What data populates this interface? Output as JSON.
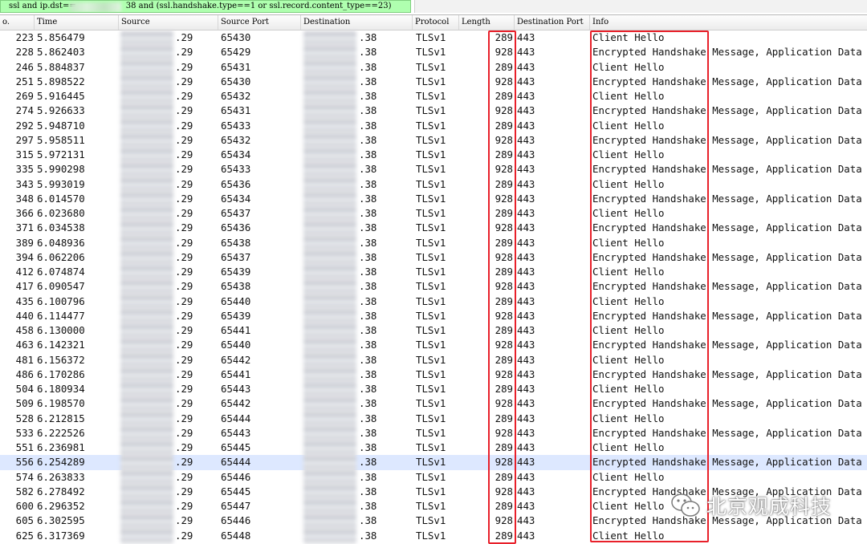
{
  "filter": {
    "text_start": "ssl and ip.dst==",
    "text_end": "38 and (ssl.handshake.type==1 or ssl.record.content_type==23)"
  },
  "columns": [
    "o.",
    "Time",
    "Source",
    "Source Port",
    "Destination",
    "Protocol",
    "Length",
    "Destination Port",
    "Info"
  ],
  "packets": [
    {
      "no": "223",
      "time": "5.856479",
      "src": ".29",
      "sport": "65430",
      "dst": ".38",
      "proto": "TLSv1",
      "len": "289",
      "dport": "443",
      "info": "Client Hello"
    },
    {
      "no": "228",
      "time": "5.862403",
      "src": ".29",
      "sport": "65429",
      "dst": ".38",
      "proto": "TLSv1",
      "len": "928",
      "dport": "443",
      "info": "Encrypted Handshake Message, Application Data"
    },
    {
      "no": "246",
      "time": "5.884837",
      "src": ".29",
      "sport": "65431",
      "dst": ".38",
      "proto": "TLSv1",
      "len": "289",
      "dport": "443",
      "info": "Client Hello"
    },
    {
      "no": "251",
      "time": "5.898522",
      "src": ".29",
      "sport": "65430",
      "dst": ".38",
      "proto": "TLSv1",
      "len": "928",
      "dport": "443",
      "info": "Encrypted Handshake Message, Application Data"
    },
    {
      "no": "269",
      "time": "5.916445",
      "src": ".29",
      "sport": "65432",
      "dst": ".38",
      "proto": "TLSv1",
      "len": "289",
      "dport": "443",
      "info": "Client Hello"
    },
    {
      "no": "274",
      "time": "5.926633",
      "src": ".29",
      "sport": "65431",
      "dst": ".38",
      "proto": "TLSv1",
      "len": "928",
      "dport": "443",
      "info": "Encrypted Handshake Message, Application Data"
    },
    {
      "no": "292",
      "time": "5.948710",
      "src": ".29",
      "sport": "65433",
      "dst": ".38",
      "proto": "TLSv1",
      "len": "289",
      "dport": "443",
      "info": "Client Hello"
    },
    {
      "no": "297",
      "time": "5.958511",
      "src": ".29",
      "sport": "65432",
      "dst": ".38",
      "proto": "TLSv1",
      "len": "928",
      "dport": "443",
      "info": "Encrypted Handshake Message, Application Data"
    },
    {
      "no": "315",
      "time": "5.972131",
      "src": ".29",
      "sport": "65434",
      "dst": ".38",
      "proto": "TLSv1",
      "len": "289",
      "dport": "443",
      "info": "Client Hello"
    },
    {
      "no": "335",
      "time": "5.990298",
      "src": ".29",
      "sport": "65433",
      "dst": ".38",
      "proto": "TLSv1",
      "len": "928",
      "dport": "443",
      "info": "Encrypted Handshake Message, Application Data"
    },
    {
      "no": "343",
      "time": "5.993019",
      "src": ".29",
      "sport": "65436",
      "dst": ".38",
      "proto": "TLSv1",
      "len": "289",
      "dport": "443",
      "info": "Client Hello"
    },
    {
      "no": "348",
      "time": "6.014570",
      "src": ".29",
      "sport": "65434",
      "dst": ".38",
      "proto": "TLSv1",
      "len": "928",
      "dport": "443",
      "info": "Encrypted Handshake Message, Application Data"
    },
    {
      "no": "366",
      "time": "6.023680",
      "src": ".29",
      "sport": "65437",
      "dst": ".38",
      "proto": "TLSv1",
      "len": "289",
      "dport": "443",
      "info": "Client Hello"
    },
    {
      "no": "371",
      "time": "6.034538",
      "src": ".29",
      "sport": "65436",
      "dst": ".38",
      "proto": "TLSv1",
      "len": "928",
      "dport": "443",
      "info": "Encrypted Handshake Message, Application Data"
    },
    {
      "no": "389",
      "time": "6.048936",
      "src": ".29",
      "sport": "65438",
      "dst": ".38",
      "proto": "TLSv1",
      "len": "289",
      "dport": "443",
      "info": "Client Hello"
    },
    {
      "no": "394",
      "time": "6.062206",
      "src": ".29",
      "sport": "65437",
      "dst": ".38",
      "proto": "TLSv1",
      "len": "928",
      "dport": "443",
      "info": "Encrypted Handshake Message, Application Data"
    },
    {
      "no": "412",
      "time": "6.074874",
      "src": ".29",
      "sport": "65439",
      "dst": ".38",
      "proto": "TLSv1",
      "len": "289",
      "dport": "443",
      "info": "Client Hello"
    },
    {
      "no": "417",
      "time": "6.090547",
      "src": ".29",
      "sport": "65438",
      "dst": ".38",
      "proto": "TLSv1",
      "len": "928",
      "dport": "443",
      "info": "Encrypted Handshake Message, Application Data"
    },
    {
      "no": "435",
      "time": "6.100796",
      "src": ".29",
      "sport": "65440",
      "dst": ".38",
      "proto": "TLSv1",
      "len": "289",
      "dport": "443",
      "info": "Client Hello"
    },
    {
      "no": "440",
      "time": "6.114477",
      "src": ".29",
      "sport": "65439",
      "dst": ".38",
      "proto": "TLSv1",
      "len": "928",
      "dport": "443",
      "info": "Encrypted Handshake Message, Application Data"
    },
    {
      "no": "458",
      "time": "6.130000",
      "src": ".29",
      "sport": "65441",
      "dst": ".38",
      "proto": "TLSv1",
      "len": "289",
      "dport": "443",
      "info": "Client Hello"
    },
    {
      "no": "463",
      "time": "6.142321",
      "src": ".29",
      "sport": "65440",
      "dst": ".38",
      "proto": "TLSv1",
      "len": "928",
      "dport": "443",
      "info": "Encrypted Handshake Message, Application Data"
    },
    {
      "no": "481",
      "time": "6.156372",
      "src": ".29",
      "sport": "65442",
      "dst": ".38",
      "proto": "TLSv1",
      "len": "289",
      "dport": "443",
      "info": "Client Hello"
    },
    {
      "no": "486",
      "time": "6.170286",
      "src": ".29",
      "sport": "65441",
      "dst": ".38",
      "proto": "TLSv1",
      "len": "928",
      "dport": "443",
      "info": "Encrypted Handshake Message, Application Data"
    },
    {
      "no": "504",
      "time": "6.180934",
      "src": ".29",
      "sport": "65443",
      "dst": ".38",
      "proto": "TLSv1",
      "len": "289",
      "dport": "443",
      "info": "Client Hello"
    },
    {
      "no": "509",
      "time": "6.198570",
      "src": ".29",
      "sport": "65442",
      "dst": ".38",
      "proto": "TLSv1",
      "len": "928",
      "dport": "443",
      "info": "Encrypted Handshake Message, Application Data"
    },
    {
      "no": "528",
      "time": "6.212815",
      "src": ".29",
      "sport": "65444",
      "dst": ".38",
      "proto": "TLSv1",
      "len": "289",
      "dport": "443",
      "info": "Client Hello"
    },
    {
      "no": "533",
      "time": "6.222526",
      "src": ".29",
      "sport": "65443",
      "dst": ".38",
      "proto": "TLSv1",
      "len": "928",
      "dport": "443",
      "info": "Encrypted Handshake Message, Application Data"
    },
    {
      "no": "551",
      "time": "6.236981",
      "src": ".29",
      "sport": "65445",
      "dst": ".38",
      "proto": "TLSv1",
      "len": "289",
      "dport": "443",
      "info": "Client Hello"
    },
    {
      "no": "556",
      "time": "6.254289",
      "src": ".29",
      "sport": "65444",
      "dst": ".38",
      "proto": "TLSv1",
      "len": "928",
      "dport": "443",
      "info": "Encrypted Handshake Message, Application Data",
      "selected": true
    },
    {
      "no": "574",
      "time": "6.263833",
      "src": ".29",
      "sport": "65446",
      "dst": ".38",
      "proto": "TLSv1",
      "len": "289",
      "dport": "443",
      "info": "Client Hello"
    },
    {
      "no": "582",
      "time": "6.278492",
      "src": ".29",
      "sport": "65445",
      "dst": ".38",
      "proto": "TLSv1",
      "len": "928",
      "dport": "443",
      "info": "Encrypted Handshake Message, Application Data"
    },
    {
      "no": "600",
      "time": "6.296352",
      "src": ".29",
      "sport": "65447",
      "dst": ".38",
      "proto": "TLSv1",
      "len": "289",
      "dport": "443",
      "info": "Client Hello"
    },
    {
      "no": "605",
      "time": "6.302595",
      "src": ".29",
      "sport": "65446",
      "dst": ".38",
      "proto": "TLSv1",
      "len": "928",
      "dport": "443",
      "info": "Encrypted Handshake Message, Application Data"
    },
    {
      "no": "625",
      "time": "6.317369",
      "src": ".29",
      "sport": "65448",
      "dst": ".38",
      "proto": "TLSv1",
      "len": "289",
      "dport": "443",
      "info": "Client Hello"
    }
  ],
  "watermark": {
    "text": "北京观成科技",
    "icon": "wechat-icon"
  },
  "colors": {
    "highlight_box": "#e8202a",
    "filter_bg": "#afffaf",
    "selected_row": "#dde8ff"
  }
}
